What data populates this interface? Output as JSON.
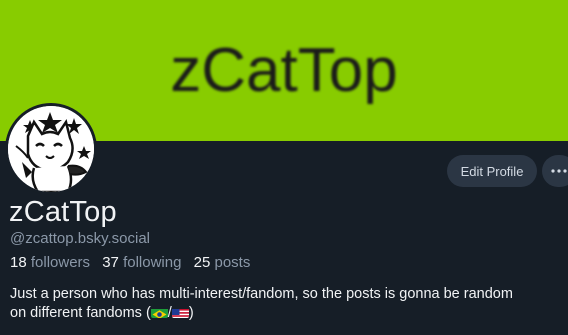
{
  "banner": {
    "text": "zCatTop"
  },
  "profile": {
    "display_name": "zCatTop",
    "handle": "@zcattop.bsky.social",
    "followers_count": "18",
    "followers_label": "followers",
    "following_count": "37",
    "following_label": "following",
    "posts_count": "25",
    "posts_label": "posts",
    "bio_line1": "Just a person who has multi-interest/fandom, so the posts is gonna be random",
    "bio_line2_prefix": "on different fandoms (",
    "bio_line2_sep": "/",
    "bio_line2_suffix": ")"
  },
  "actions": {
    "edit_profile_label": "Edit Profile",
    "more_label": "···"
  },
  "colors": {
    "banner": "#88cc00",
    "background": "#161e27",
    "button": "#2b3644",
    "muted_text": "#8b98a8",
    "primary_text": "#f1f3f5"
  },
  "icons": {
    "flag_1": "brazil-flag-icon",
    "flag_2": "usa-flag-icon",
    "more": "ellipsis-icon"
  }
}
